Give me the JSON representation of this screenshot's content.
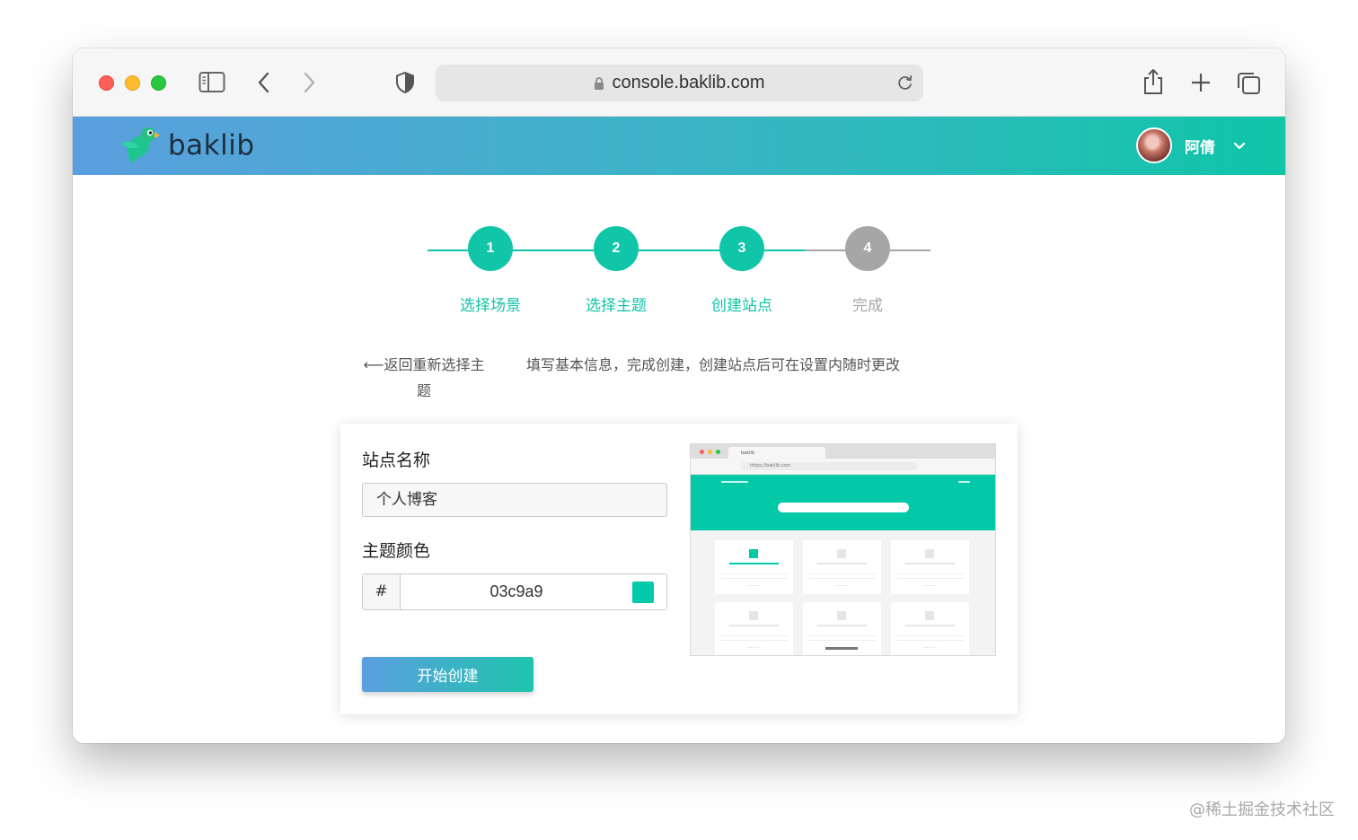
{
  "browser": {
    "url": "console.baklib.com"
  },
  "header": {
    "logo_text": "baklib",
    "user_name": "阿倩",
    "gradient_start": "#5b9fdf",
    "gradient_end": "#10c5a8"
  },
  "steps": {
    "active_color": "#10c5a8",
    "inactive_color": "#a6a6a6",
    "items": [
      {
        "number": "1",
        "label": "选择场景",
        "done": true
      },
      {
        "number": "2",
        "label": "选择主题",
        "done": true
      },
      {
        "number": "3",
        "label": "创建站点",
        "done": true
      },
      {
        "number": "4",
        "label": "完成",
        "done": false
      }
    ]
  },
  "nav": {
    "back_label": "返回重新选择主题",
    "hint": "填写基本信息，完成创建，创建站点后可在设置内随时更改"
  },
  "form": {
    "site_name_label": "站点名称",
    "site_name_value": "个人博客",
    "theme_color_label": "主题颜色",
    "hash_symbol": "#",
    "color_value": "03c9a9",
    "swatch_color": "#03c9a9",
    "submit_label": "开始创建"
  },
  "preview": {
    "tab_title": "baklib",
    "url": "https://baklib.com",
    "accent_color": "#03c9a9"
  },
  "watermark": "@稀土掘金技术社区"
}
